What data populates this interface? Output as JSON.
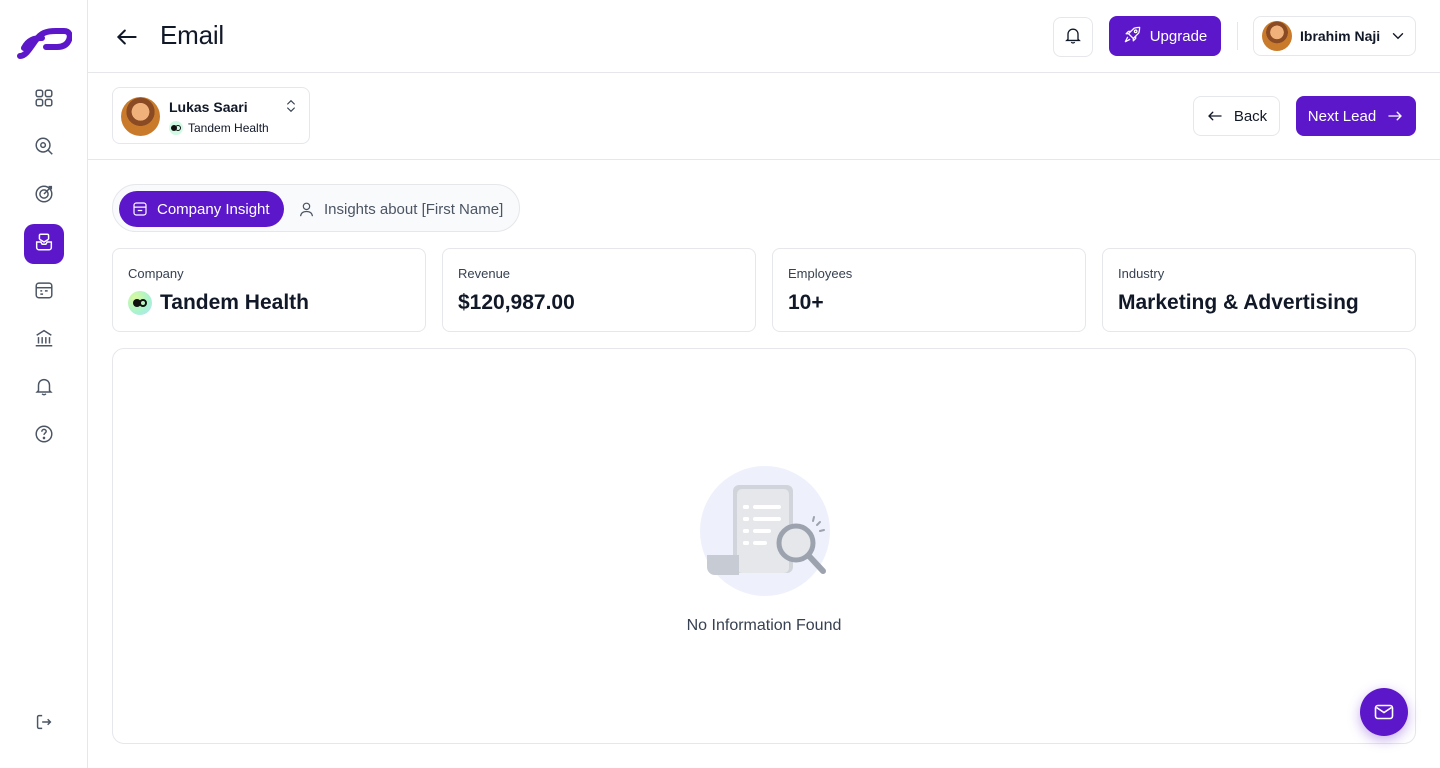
{
  "header": {
    "title": "Email",
    "upgrade_label": "Upgrade",
    "user_name": "Ibrahim Naji"
  },
  "lead": {
    "name": "Lukas Saari",
    "company": "Tandem Health",
    "back_label": "Back",
    "next_label": "Next Lead"
  },
  "tabs": [
    {
      "label": "Company Insight",
      "active": true
    },
    {
      "label": "Insights about [First Name]",
      "active": false
    }
  ],
  "stats": [
    {
      "label": "Company",
      "value": "Tandem Health"
    },
    {
      "label": "Revenue",
      "value": "$120,987.00"
    },
    {
      "label": "Employees",
      "value": "10+"
    },
    {
      "label": "Industry",
      "value": "Marketing & Advertising"
    }
  ],
  "empty_state": {
    "message": "No Information Found"
  },
  "sidebar": {
    "items": [
      {
        "icon": "grid-icon"
      },
      {
        "icon": "search-icon"
      },
      {
        "icon": "target-icon"
      },
      {
        "icon": "inbox-icon",
        "active": true
      },
      {
        "icon": "calendar-icon"
      },
      {
        "icon": "bank-icon"
      },
      {
        "icon": "bell-icon"
      },
      {
        "icon": "help-icon"
      },
      {
        "icon": "logout-icon"
      }
    ]
  },
  "colors": {
    "accent": "#5b17c9",
    "border": "#e5e7eb"
  }
}
